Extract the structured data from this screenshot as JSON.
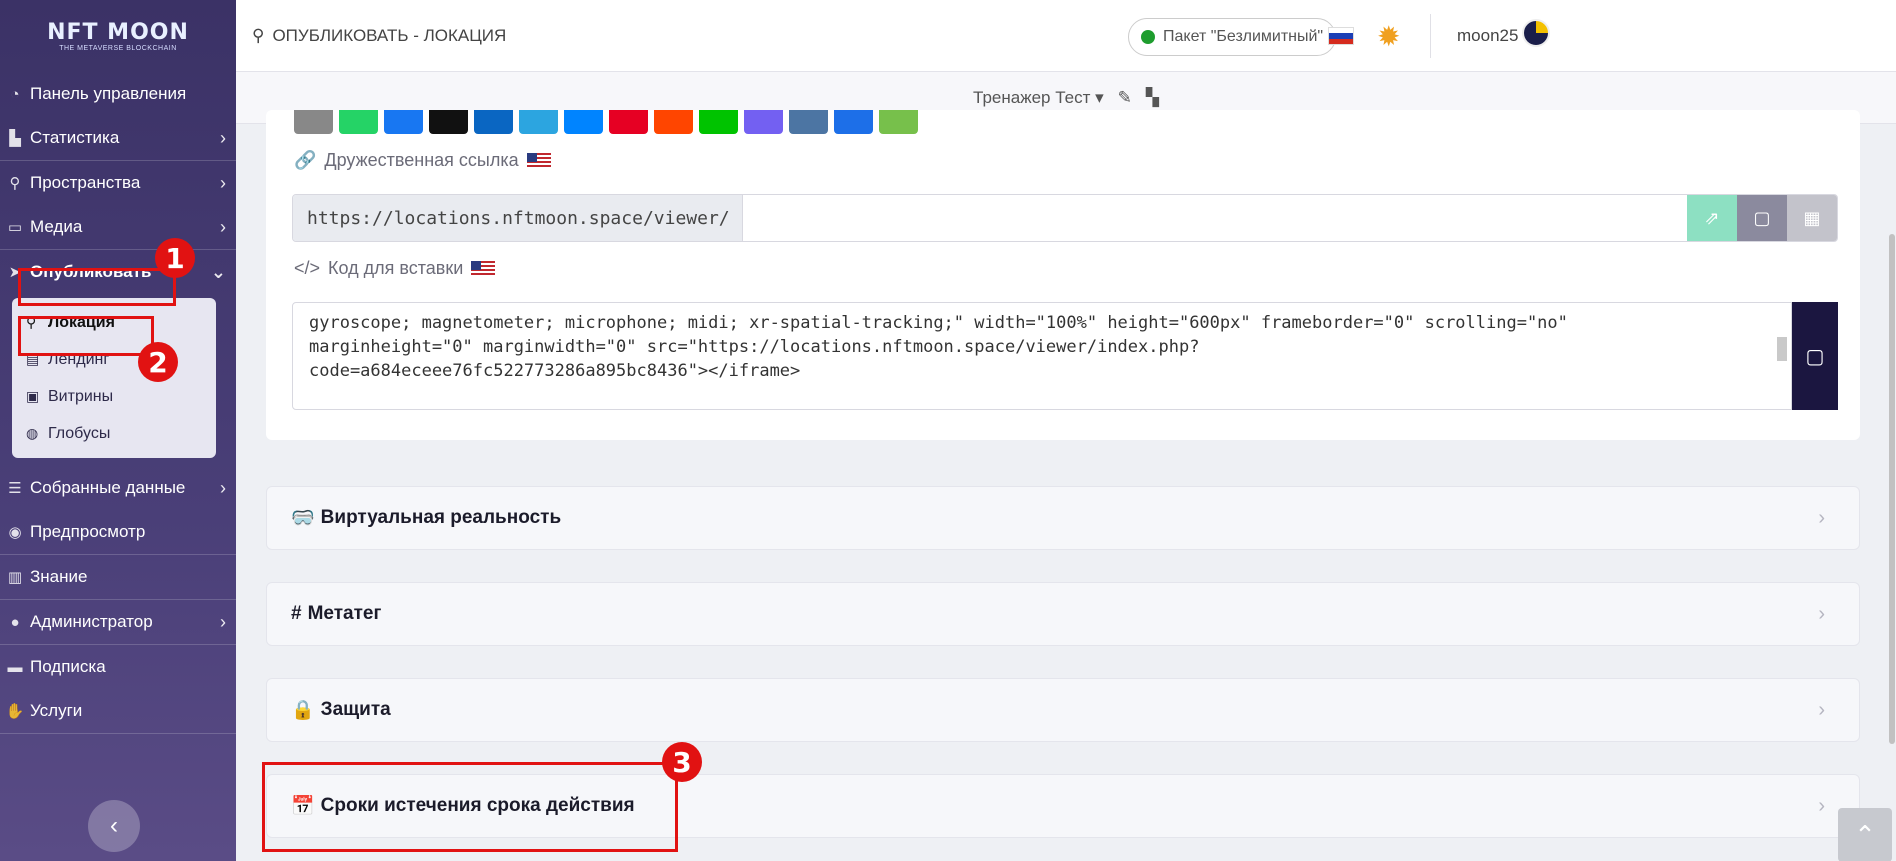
{
  "brand": {
    "title": "NFT MOON",
    "subtitle": "THE METAVERSE BLOCKCHAIN"
  },
  "sidebar": {
    "items": [
      {
        "label": "Панель управления",
        "icon": "dashboard-icon",
        "chevron": false
      },
      {
        "label": "Статистика",
        "icon": "chart-icon",
        "chevron": true
      },
      {
        "label": "Пространства",
        "icon": "route-icon",
        "chevron": true
      },
      {
        "label": "Медиа",
        "icon": "monitor-icon",
        "chevron": true
      },
      {
        "label": "Опубликовать",
        "icon": "paper-plane-icon",
        "chevron": true
      },
      {
        "label": "Собранные данные",
        "icon": "database-icon",
        "chevron": true
      },
      {
        "label": "Предпросмотр",
        "icon": "eye-icon",
        "chevron": false
      },
      {
        "label": "Знание",
        "icon": "map-icon",
        "chevron": false
      },
      {
        "label": "Администратор",
        "icon": "user-icon",
        "chevron": true
      },
      {
        "label": "Подписка",
        "icon": "card-icon",
        "chevron": false
      },
      {
        "label": "Услуги",
        "icon": "hand-icon",
        "chevron": false
      }
    ],
    "publish_sub": [
      {
        "label": "Локация",
        "icon": "route-icon"
      },
      {
        "label": "Лендинг",
        "icon": "file-icon"
      },
      {
        "label": "Витрины",
        "icon": "image-icon"
      },
      {
        "label": "Глобусы",
        "icon": "globe-icon"
      }
    ]
  },
  "topbar": {
    "breadcrumb": "ОПУБЛИКОВАТЬ - ЛОКАЦИЯ",
    "package": "Пакет \"Безлимитный\"",
    "username": "moon25"
  },
  "subbar": {
    "title": "Тренажер Тест"
  },
  "share": {
    "colors": [
      "#888888",
      "#25d366",
      "#1877f2",
      "#111111",
      "#0a66c2",
      "#2ca5e0",
      "#0084ff",
      "#e60023",
      "#ff4500",
      "#00c300",
      "#7360f2",
      "#4c75a3",
      "#1d6fe8",
      "#77c04b"
    ]
  },
  "friendly_link": {
    "label": "Дружественная ссылка",
    "prefix": "https://locations.nftmoon.space/viewer/",
    "value": ""
  },
  "embed": {
    "label": "Код для вставки",
    "lines": [
      "gyroscope; magnetometer; microphone; midi; xr-spatial-tracking;\" width=\"100%\" height=\"600px\" frameborder=\"0\" scrolling=\"no\"",
      "marginheight=\"0\" marginwidth=\"0\" src=\"https://locations.nftmoon.space/viewer/index.php?",
      "code=a684eceee76fc522773286a895bc8436\"></iframe>"
    ]
  },
  "panels": [
    {
      "label": "Виртуальная реальность",
      "icon": "vr-goggles-icon",
      "glyph": "🥽"
    },
    {
      "label": "Метатег",
      "icon": "hash-icon",
      "glyph": "#"
    },
    {
      "label": "Защита",
      "icon": "lock-icon",
      "glyph": "🔒"
    },
    {
      "label": "Сроки истечения срока действия",
      "icon": "calendar-icon",
      "glyph": "📅"
    }
  ],
  "annotations": [
    "1",
    "2",
    "3"
  ],
  "colors": {
    "accent_green": "#8de0c2",
    "accent_gray": "#8b8a9e",
    "dark": "#1b1640",
    "red": "#e11212"
  }
}
